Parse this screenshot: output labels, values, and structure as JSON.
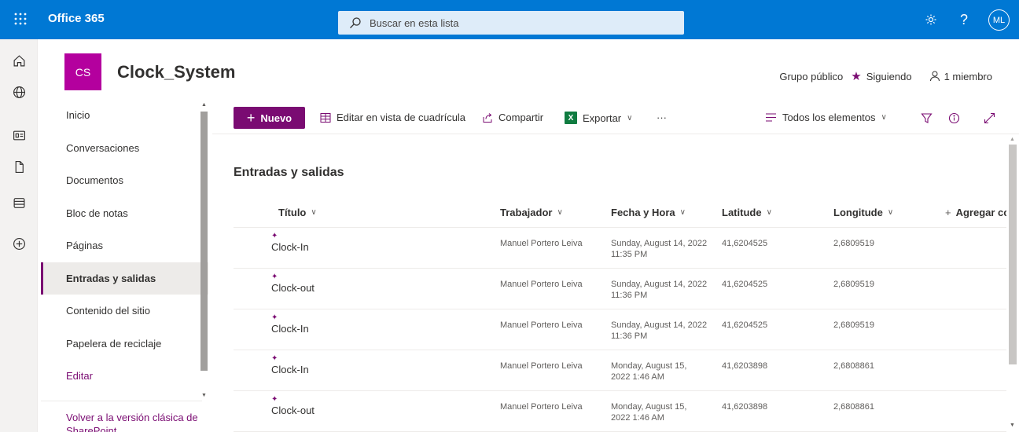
{
  "suite": {
    "title": "Office 365",
    "search_placeholder": "Buscar en esta lista",
    "avatar_initials": "ML",
    "help_label": "?",
    "brand_color": "#0078d4"
  },
  "site": {
    "logo_initials": "CS",
    "title": "Clock_System",
    "group_type": "Grupo público",
    "follow_label": "Siguiendo",
    "members_label": "1 miembro",
    "accent_color": "#7a0b72"
  },
  "nav": {
    "items": [
      {
        "label": "Inicio"
      },
      {
        "label": "Conversaciones"
      },
      {
        "label": "Documentos"
      },
      {
        "label": "Bloc de notas"
      },
      {
        "label": "Páginas"
      },
      {
        "label": "Entradas y salidas",
        "selected": true
      },
      {
        "label": "Contenido del sitio"
      },
      {
        "label": "Papelera de reciclaje"
      },
      {
        "label": "Editar"
      }
    ],
    "classic_link": "Volver a la versión clásica de SharePoint"
  },
  "commandbar": {
    "new_label": "Nuevo",
    "grid_edit_label": "Editar en vista de cuadrícula",
    "share_label": "Compartir",
    "export_label": "Exportar",
    "more_label": "···",
    "view_label": "Todos los elementos"
  },
  "list": {
    "title": "Entradas y salidas",
    "columns": {
      "titulo": "Título",
      "trabajador": "Trabajador",
      "fecha": "Fecha y Hora",
      "latitude": "Latitude",
      "longitude": "Longitude",
      "add": "Agregar co"
    },
    "rows": [
      {
        "titulo": "Clock-In",
        "trabajador": "Manuel Portero Leiva",
        "fecha_1": "Sunday, August 14, 2022",
        "fecha_2": "11:35 PM",
        "latitude": "41,6204525",
        "longitude": "2,6809519"
      },
      {
        "titulo": "Clock-out",
        "trabajador": "Manuel Portero Leiva",
        "fecha_1": "Sunday, August 14, 2022",
        "fecha_2": "11:36 PM",
        "latitude": "41,6204525",
        "longitude": "2,6809519"
      },
      {
        "titulo": "Clock-In",
        "trabajador": "Manuel Portero Leiva",
        "fecha_1": "Sunday, August 14, 2022",
        "fecha_2": "11:36 PM",
        "latitude": "41,6204525",
        "longitude": "2,6809519"
      },
      {
        "titulo": "Clock-In",
        "trabajador": "Manuel Portero Leiva",
        "fecha_1": "Monday, August 15,",
        "fecha_2": "2022 1:46 AM",
        "latitude": "41,6203898",
        "longitude": "2,6808861"
      },
      {
        "titulo": "Clock-out",
        "trabajador": "Manuel Portero Leiva",
        "fecha_1": "Monday, August 15,",
        "fecha_2": "2022 1:46 AM",
        "latitude": "41,6203898",
        "longitude": "2,6808861"
      }
    ]
  }
}
